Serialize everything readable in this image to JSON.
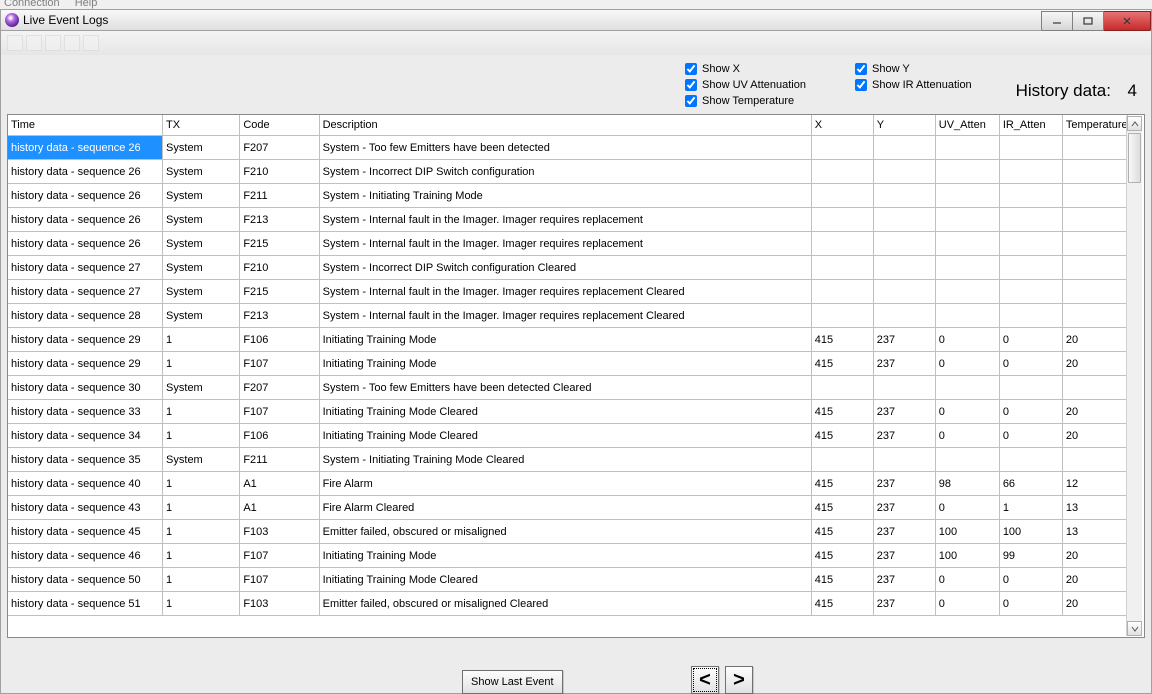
{
  "background_menu": {
    "item1": "Connection",
    "item2": "Help"
  },
  "window": {
    "title": "Live Event Logs"
  },
  "checks": {
    "show_x": "Show X",
    "show_y": "Show Y",
    "show_uv": "Show UV Attenuation",
    "show_ir": "Show IR Attenuation",
    "show_temp": "Show Temperature"
  },
  "history": {
    "label": "History  data:",
    "count": "4"
  },
  "columns": {
    "time": "Time",
    "tx": "TX",
    "code": "Code",
    "desc": "Description",
    "x": "X",
    "y": "Y",
    "uv": "UV_Atten",
    "ir": "IR_Atten",
    "temp": "Temperature"
  },
  "buttons": {
    "show_last": "Show Last Event",
    "prev_glyph": "<",
    "next_glyph": ">"
  },
  "rows": [
    {
      "time": "history data - sequence 26",
      "tx": "System",
      "code": "F207",
      "desc": "System - Too few Emitters have been detected",
      "x": "",
      "y": "",
      "uv": "",
      "ir": "",
      "temp": ""
    },
    {
      "time": "history data - sequence 26",
      "tx": "System",
      "code": "F210",
      "desc": "System - Incorrect DIP Switch configuration",
      "x": "",
      "y": "",
      "uv": "",
      "ir": "",
      "temp": ""
    },
    {
      "time": "history data - sequence 26",
      "tx": "System",
      "code": "F211",
      "desc": "System - Initiating Training Mode",
      "x": "",
      "y": "",
      "uv": "",
      "ir": "",
      "temp": ""
    },
    {
      "time": "history data - sequence 26",
      "tx": "System",
      "code": "F213",
      "desc": "System - Internal fault in the Imager. Imager requires replacement",
      "x": "",
      "y": "",
      "uv": "",
      "ir": "",
      "temp": ""
    },
    {
      "time": "history data - sequence 26",
      "tx": "System",
      "code": "F215",
      "desc": "System - Internal fault in the Imager. Imager requires replacement",
      "x": "",
      "y": "",
      "uv": "",
      "ir": "",
      "temp": ""
    },
    {
      "time": "history data - sequence 27",
      "tx": "System",
      "code": "F210",
      "desc": "System - Incorrect DIP Switch configuration Cleared",
      "x": "",
      "y": "",
      "uv": "",
      "ir": "",
      "temp": ""
    },
    {
      "time": "history data - sequence 27",
      "tx": "System",
      "code": "F215",
      "desc": "System - Internal fault in the Imager. Imager requires replacement Cleared",
      "x": "",
      "y": "",
      "uv": "",
      "ir": "",
      "temp": ""
    },
    {
      "time": "history data - sequence 28",
      "tx": "System",
      "code": "F213",
      "desc": "System - Internal fault in the Imager. Imager requires replacement Cleared",
      "x": "",
      "y": "",
      "uv": "",
      "ir": "",
      "temp": ""
    },
    {
      "time": "history data - sequence 29",
      "tx": "1",
      "code": "F106",
      "desc": "Initiating Training Mode",
      "x": "415",
      "y": "237",
      "uv": "0",
      "ir": "0",
      "temp": "20"
    },
    {
      "time": "history data - sequence 29",
      "tx": "1",
      "code": "F107",
      "desc": "Initiating Training Mode",
      "x": "415",
      "y": "237",
      "uv": "0",
      "ir": "0",
      "temp": "20"
    },
    {
      "time": "history data - sequence 30",
      "tx": "System",
      "code": "F207",
      "desc": "System - Too few Emitters have been detected Cleared",
      "x": "",
      "y": "",
      "uv": "",
      "ir": "",
      "temp": ""
    },
    {
      "time": "history data - sequence 33",
      "tx": "1",
      "code": "F107",
      "desc": "Initiating Training Mode Cleared",
      "x": "415",
      "y": "237",
      "uv": "0",
      "ir": "0",
      "temp": "20"
    },
    {
      "time": "history data - sequence 34",
      "tx": "1",
      "code": "F106",
      "desc": "Initiating Training Mode Cleared",
      "x": "415",
      "y": "237",
      "uv": "0",
      "ir": "0",
      "temp": "20"
    },
    {
      "time": "history data - sequence 35",
      "tx": "System",
      "code": "F211",
      "desc": "System - Initiating Training Mode Cleared",
      "x": "",
      "y": "",
      "uv": "",
      "ir": "",
      "temp": ""
    },
    {
      "time": "history data - sequence 40",
      "tx": "1",
      "code": "A1",
      "desc": "Fire Alarm",
      "x": "415",
      "y": "237",
      "uv": "98",
      "ir": "66",
      "temp": "12"
    },
    {
      "time": "history data - sequence 43",
      "tx": "1",
      "code": "A1",
      "desc": "Fire Alarm Cleared",
      "x": "415",
      "y": "237",
      "uv": "0",
      "ir": "1",
      "temp": "13"
    },
    {
      "time": "history data - sequence 45",
      "tx": "1",
      "code": "F103",
      "desc": "Emitter failed, obscured or misaligned",
      "x": "415",
      "y": "237",
      "uv": "100",
      "ir": "100",
      "temp": "13"
    },
    {
      "time": "history data - sequence 46",
      "tx": "1",
      "code": "F107",
      "desc": "Initiating Training Mode",
      "x": "415",
      "y": "237",
      "uv": "100",
      "ir": "99",
      "temp": "20"
    },
    {
      "time": "history data - sequence 50",
      "tx": "1",
      "code": "F107",
      "desc": "Initiating Training Mode Cleared",
      "x": "415",
      "y": "237",
      "uv": "0",
      "ir": "0",
      "temp": "20"
    },
    {
      "time": "history data - sequence 51",
      "tx": "1",
      "code": "F103",
      "desc": "Emitter failed, obscured or misaligned Cleared",
      "x": "415",
      "y": "237",
      "uv": "0",
      "ir": "0",
      "temp": "20"
    }
  ]
}
